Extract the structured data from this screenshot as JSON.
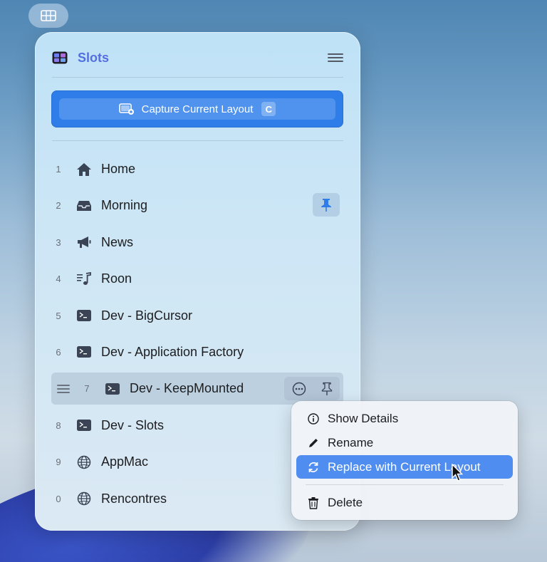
{
  "panel": {
    "title": "Slots",
    "capture": {
      "label": "Capture Current Layout",
      "shortcut": "C"
    }
  },
  "slots": [
    {
      "number": "1",
      "label": "Home",
      "icon": "house-icon"
    },
    {
      "number": "2",
      "label": "Morning",
      "icon": "tray-icon",
      "pinned": true
    },
    {
      "number": "3",
      "label": "News",
      "icon": "megaphone-icon"
    },
    {
      "number": "4",
      "label": "Roon",
      "icon": "music-list-icon"
    },
    {
      "number": "5",
      "label": "Dev - BigCursor",
      "icon": "terminal-icon"
    },
    {
      "number": "6",
      "label": "Dev - Application Factory",
      "icon": "terminal-icon"
    },
    {
      "number": "7",
      "label": "Dev - KeepMounted",
      "icon": "terminal-icon",
      "active": true
    },
    {
      "number": "8",
      "label": "Dev - Slots",
      "icon": "terminal-icon"
    },
    {
      "number": "9",
      "label": "AppMac",
      "icon": "globe-icon"
    },
    {
      "number": "0",
      "label": "Rencontres",
      "icon": "globe-icon"
    }
  ],
  "context_menu": {
    "items": [
      {
        "label": "Show Details",
        "icon": "info-icon"
      },
      {
        "label": "Rename",
        "icon": "pencil-icon"
      },
      {
        "label": "Replace with Current Layout",
        "icon": "refresh-icon",
        "highlighted": true
      },
      {
        "label": "Delete",
        "icon": "trash-icon"
      }
    ]
  },
  "colors": {
    "accent": "#2f7de8",
    "highlight": "#4f8ef0"
  }
}
